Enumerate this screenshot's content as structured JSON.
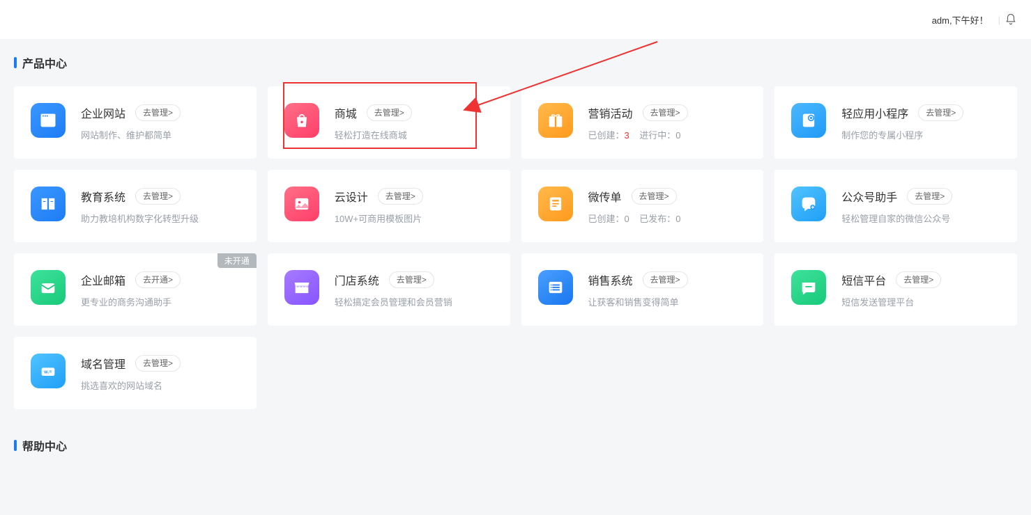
{
  "header": {
    "greeting": "adm,下午好！"
  },
  "section1_title": "产品中心",
  "section2_title": "帮助中心",
  "cards": [
    {
      "title": "企业网站",
      "btn": "去管理>",
      "desc": "网站制作、维护都简单"
    },
    {
      "title": "商城",
      "btn": "去管理>",
      "desc": "轻松打造在线商城"
    },
    {
      "title": "营销活动",
      "btn": "去管理>",
      "stats_created_label": "已创建：",
      "stats_created_val": "3",
      "stats_running_label": "进行中：",
      "stats_running_val": "0"
    },
    {
      "title": "轻应用小程序",
      "btn": "去管理>",
      "desc": "制作您的专属小程序"
    },
    {
      "title": "教育系统",
      "btn": "去管理>",
      "desc": "助力教培机构数字化转型升级"
    },
    {
      "title": "云设计",
      "btn": "去管理>",
      "desc": "10W+可商用模板图片"
    },
    {
      "title": "微传单",
      "btn": "去管理>",
      "stats_created_label": "已创建：",
      "stats_created_val": "0",
      "stats_pub_label": "已发布：",
      "stats_pub_val": "0"
    },
    {
      "title": "公众号助手",
      "btn": "去管理>",
      "desc": "轻松管理自家的微信公众号"
    },
    {
      "title": "企业邮箱",
      "btn": "去开通>",
      "desc": "更专业的商务沟通助手",
      "badge": "未开通"
    },
    {
      "title": "门店系统",
      "btn": "去管理>",
      "desc": "轻松搞定会员管理和会员营销"
    },
    {
      "title": "销售系统",
      "btn": "去管理>",
      "desc": "让获客和销售变得简单"
    },
    {
      "title": "短信平台",
      "btn": "去管理>",
      "desc": "短信发送管理平台"
    },
    {
      "title": "域名管理",
      "btn": "去管理>",
      "desc": "挑选喜欢的网站域名"
    }
  ]
}
